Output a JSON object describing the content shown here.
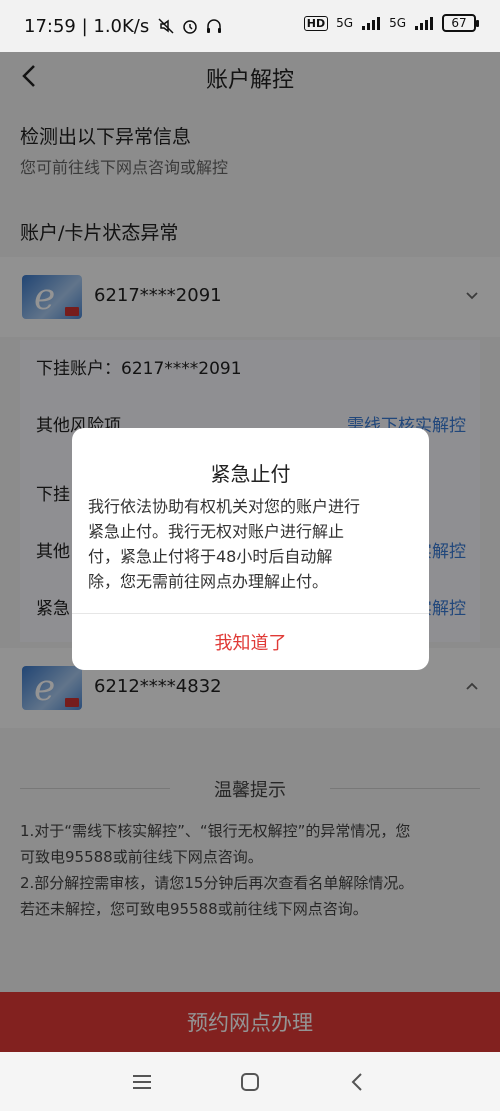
{
  "status_bar": {
    "text": "17:59 | 1.0K/s",
    "network1": "5G",
    "network2": "5G",
    "hd": "HD",
    "battery": "67"
  },
  "nav": {
    "title": "账户解控"
  },
  "intro": {
    "heading": "检测出以下异常信息",
    "sub": "您可前往线下网点咨询或解控"
  },
  "section": {
    "title": "账户/卡片状态异常"
  },
  "cards": [
    {
      "number": "6217****2091"
    },
    {
      "number": "6212****4832"
    }
  ],
  "details": {
    "rows": [
      {
        "label": "下挂账户：6217****2091",
        "link": ""
      },
      {
        "label": "其他风险项",
        "link": "需线下核实解控"
      },
      {
        "label": "下挂",
        "link": ""
      },
      {
        "label": "其他",
        "link": "实解控"
      },
      {
        "label": "紧急",
        "link": "实解控"
      }
    ]
  },
  "tips": {
    "title": "温馨提示",
    "lines": [
      "1.对于“需线下核实解控”、“银行无权解控”的异常情况，您",
      "可致电95588或前往线下网点咨询。",
      "2.部分解控需审核，请您15分钟后再次查看名单解除情况。",
      "若还未解控，您可致电95588或前往线下网点咨询。"
    ]
  },
  "bottom_button": "预约网点办理",
  "dialog": {
    "title": "紧急止付",
    "lines": [
      "我行依法协助有权机关对您的账户进行",
      "紧急止付。我行无权对账户进行解止",
      "付，紧急止付将于48小时后自动解",
      "除，您无需前往网点办理解止付。"
    ],
    "button": "我知道了"
  },
  "colors": {
    "accent": "#e03a36",
    "link": "#3a7bd5"
  }
}
